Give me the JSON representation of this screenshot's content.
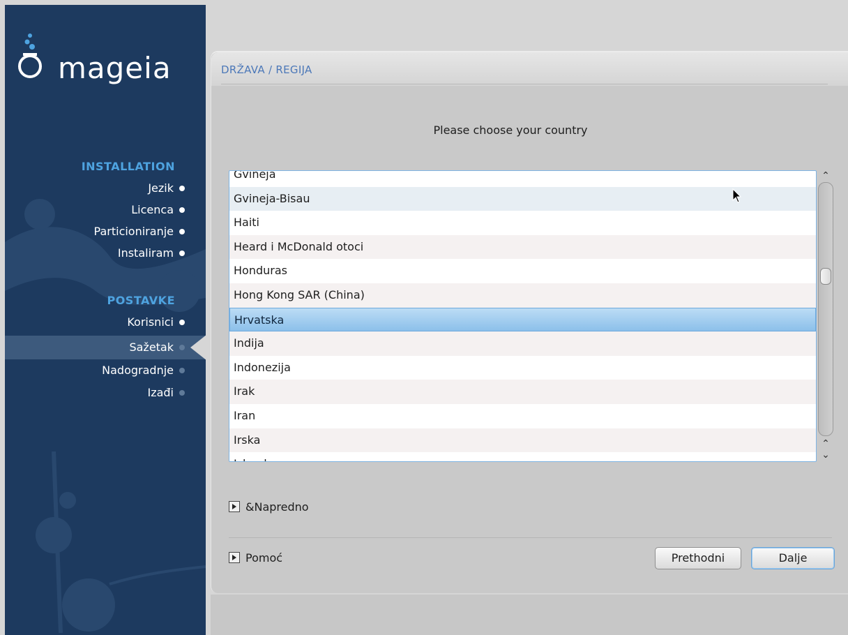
{
  "brand": {
    "name": "mageia"
  },
  "sidebar": {
    "sections": [
      {
        "heading": "INSTALLATION",
        "items": [
          {
            "label": "Jezik"
          },
          {
            "label": "Licenca"
          },
          {
            "label": "Particioniranje"
          },
          {
            "label": "Instaliram"
          }
        ]
      },
      {
        "heading": "POSTAVKE",
        "items": [
          {
            "label": "Korisnici"
          },
          {
            "label": "Sažetak"
          },
          {
            "label": "Nadogradnje"
          },
          {
            "label": "Izađi"
          }
        ]
      }
    ],
    "active_item": "Sažetak"
  },
  "panel": {
    "title": "DRŽAVA / REGIJA",
    "prompt": "Please choose your country"
  },
  "country_list": {
    "items": [
      "Gvineja",
      "Gvineja-Bisau",
      "Haiti",
      "Heard i McDonald otoci",
      "Honduras",
      "Hong Kong SAR (China)",
      "Hrvatska",
      "Indija",
      "Indonezija",
      "Irak",
      "Iran",
      "Irska",
      "Island"
    ],
    "selected": "Hrvatska",
    "hovered": "Gvineja-Bisau",
    "scroll_position_fraction": 0.36
  },
  "expanders": {
    "advanced": "&Napredno",
    "help": "Pomoć"
  },
  "buttons": {
    "previous": "Prethodni",
    "next": "Dalje"
  },
  "colors": {
    "sidebar_bg": "#1d3a5f",
    "heading_blue": "#4ea3e0",
    "title_blue": "#4c78b8",
    "selection": "#8cc0ea"
  }
}
